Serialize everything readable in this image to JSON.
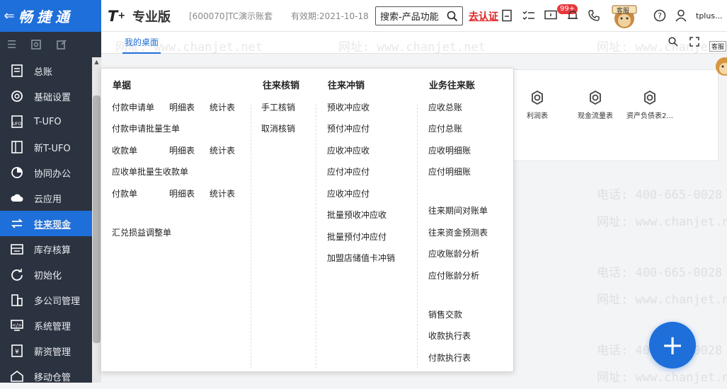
{
  "brand": {
    "name": "畅捷通",
    "back_glyph": "⇐"
  },
  "header": {
    "logo": "T",
    "logo_sup": "+",
    "edition": "专业版",
    "account": "[600070]TC演示账套",
    "validity": "有效期:2021-10-18",
    "search_label": "搜索-产品功能",
    "auth_link": "去认证",
    "badge": "99+",
    "kefu": "客服",
    "user": "tplus..."
  },
  "sidebar": {
    "items": [
      {
        "label": "总账",
        "icon": "ledger-icon"
      },
      {
        "label": "基础设置",
        "icon": "settings-icon"
      },
      {
        "label": "T-UFO",
        "icon": "ufo-icon"
      },
      {
        "label": "新T-UFO",
        "icon": "new-ufo-icon"
      },
      {
        "label": "协同办公",
        "icon": "collaboration-icon"
      },
      {
        "label": "云应用",
        "icon": "cloud-icon"
      },
      {
        "label": "往来现金",
        "icon": "exchange-icon"
      },
      {
        "label": "库存核算",
        "icon": "inventory-icon"
      },
      {
        "label": "初始化",
        "icon": "init-icon"
      },
      {
        "label": "多公司管理",
        "icon": "company-icon"
      },
      {
        "label": "系统管理",
        "icon": "system-icon"
      },
      {
        "label": "薪资管理",
        "icon": "salary-icon"
      },
      {
        "label": "移动仓管",
        "icon": "mobile-warehouse-icon"
      }
    ]
  },
  "tabs": {
    "home": "我的桌面"
  },
  "reports": [
    {
      "label": "利润表"
    },
    {
      "label": "现金流量表"
    },
    {
      "label": "资产负债表2..."
    }
  ],
  "menu": {
    "col1": {
      "title": "单据",
      "items": {
        "a1": "付款申请单",
        "a2": "明细表",
        "a3": "统计表",
        "b1": "付款申请批量生单",
        "c1": "收款单",
        "c2": "明细表",
        "c3": "统计表",
        "d1": "应收单批量生收款单",
        "e1": "付款单",
        "e2": "明细表",
        "e3": "统计表",
        "f1": "汇兑损益调整单"
      }
    },
    "col2": {
      "title": "往来核销",
      "items": [
        "手工核销",
        "取消核销"
      ]
    },
    "col3": {
      "title": "往来冲销",
      "items": [
        "预收冲应收",
        "预付冲应付",
        "应收冲应收",
        "应付冲应付",
        "应收冲应付",
        "批量预收冲应收",
        "批量预付冲应付",
        "加盟店储值卡冲销"
      ]
    },
    "col4": {
      "title": "业务往来账",
      "items": [
        "应收总账",
        "应付总账",
        "应收明细账",
        "应付明细账",
        "往来期间对账单",
        "往来资金预测表",
        "应收账龄分析",
        "应付账龄分析",
        "销售交款",
        "收款执行表",
        "付款执行表"
      ]
    }
  },
  "watermark": {
    "phone": "电话: 400-665-0028",
    "site": "网址: www.chanjet.net",
    "phone_short": "665-0028",
    "site_short": "chanjet.net"
  },
  "fab": {
    "label": "+"
  },
  "colors": {
    "primary": "#1e6fd9",
    "sidebar": "#2c3340",
    "danger": "#e02020"
  }
}
